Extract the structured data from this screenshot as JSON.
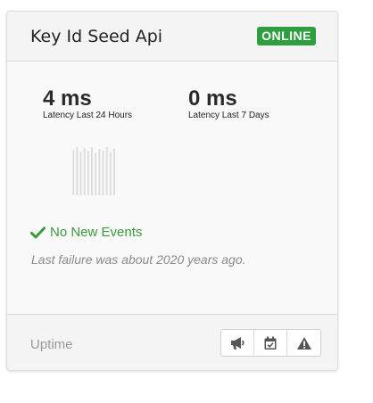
{
  "card": {
    "title": "Key Id Seed Api",
    "status": "ONLINE",
    "status_color": "#2e9e3e"
  },
  "metrics": [
    {
      "value": "4 ms",
      "label": "Latency Last 24 Hours"
    },
    {
      "value": "0 ms",
      "label": "Latency Last 7 Days"
    }
  ],
  "sparkline": {
    "values": [
      0.95,
      1.0,
      0.9,
      0.98,
      0.92,
      1.0,
      0.88,
      0.96,
      0.93,
      1.0,
      0.9,
      0.97
    ],
    "color": "#dcdcdc"
  },
  "events": {
    "text": "No New Events",
    "icon": "check-icon",
    "color": "#3a9a3d"
  },
  "last_failure": "Last failure was about 2020 years ago.",
  "footer": {
    "label": "Uptime",
    "buttons": [
      {
        "icon": "megaphone-icon"
      },
      {
        "icon": "calendar-check-icon"
      },
      {
        "icon": "warning-icon"
      }
    ]
  }
}
